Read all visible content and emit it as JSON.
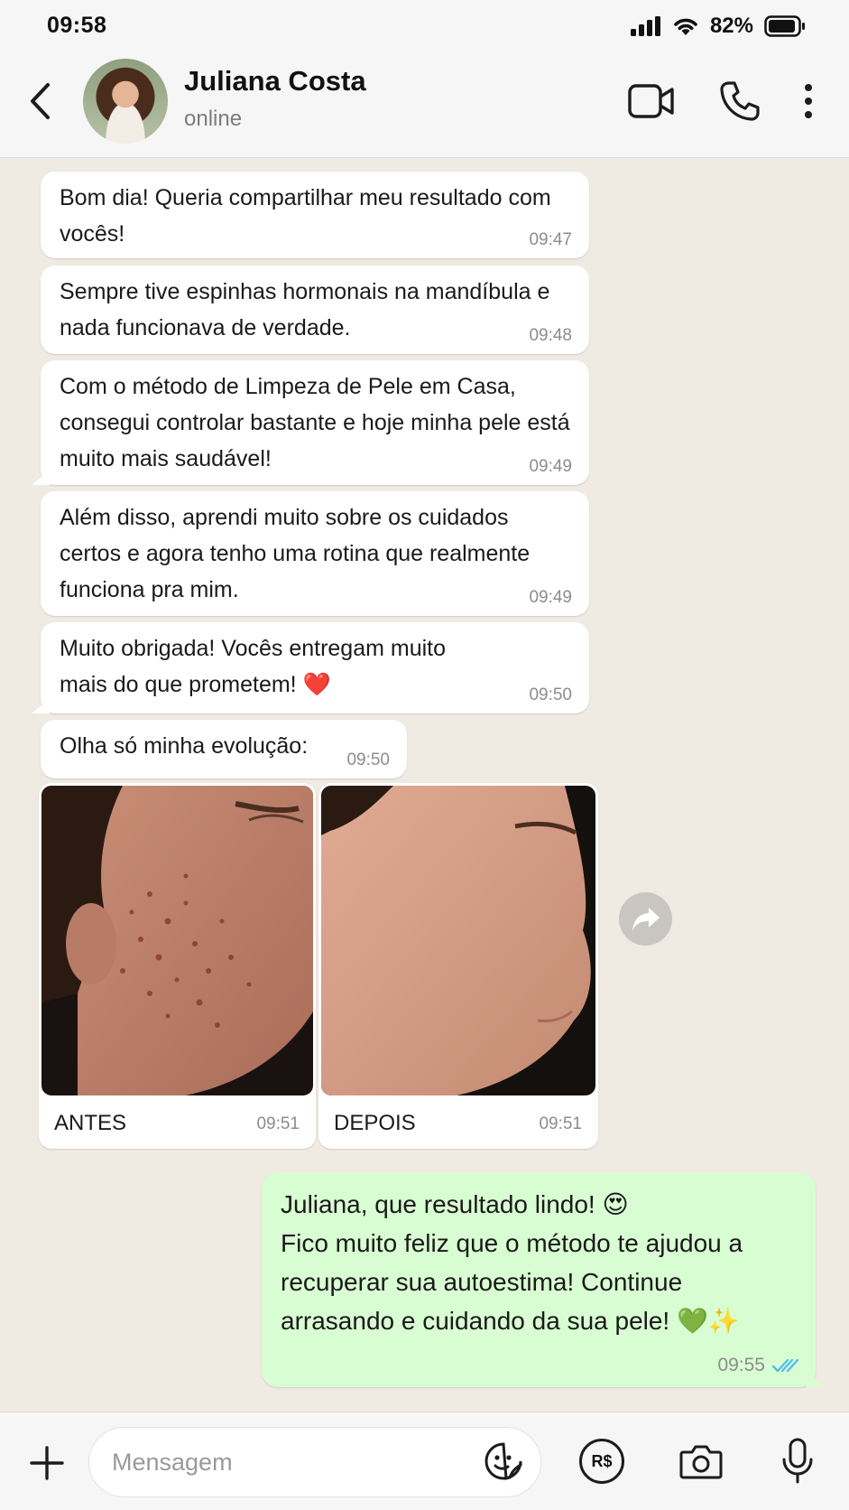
{
  "status_bar": {
    "time": "09:58",
    "battery": "82%"
  },
  "header": {
    "contact_name": "Juliana Costa",
    "contact_status": "online"
  },
  "messages": [
    {
      "text": "Bom dia! Queria compartilhar meu resultado com vocês!",
      "time": "09:47"
    },
    {
      "text": "Sempre tive espinhas hormonais na mandíbula e nada funcionava de verdade.",
      "time": "09:48"
    },
    {
      "text": "Com o método de Limpeza de Pele em Casa, consegui controlar bastante e hoje minha pele está muito mais saudável!",
      "time": "09:49"
    },
    {
      "text": "Além disso, aprendi muito sobre os cuidados certos e agora tenho uma rotina que realmente funciona pra mim.",
      "time": "09:49"
    },
    {
      "text": "Muito obrigada! Vocês entregam muito mais do que prometem! ❤️",
      "time": "09:50"
    },
    {
      "text": "Olha só minha evolução:",
      "time": "09:50"
    }
  ],
  "images": [
    {
      "caption": "ANTES",
      "time": "09:51"
    },
    {
      "caption": "DEPOIS",
      "time": "09:51"
    }
  ],
  "outgoing": {
    "text": "Juliana, que resultado lindo! 😍\nFico muito feliz que o método te ajudou a recuperar sua autoestima! Continue arrasando e cuidando da sua pele! 💚✨",
    "time": "09:55"
  },
  "composer": {
    "placeholder": "Mensagem",
    "pay_label": "R$"
  },
  "icons": [
    "back-arrow-icon",
    "video-call-icon",
    "phone-icon",
    "more-vert-icon",
    "forward-icon",
    "plus-icon",
    "sticker-icon",
    "camera-icon",
    "mic-icon",
    "double-check-icon"
  ],
  "colors": {
    "chat_bg": "#efeae2",
    "outgoing_bubble": "#d9fdd3",
    "read_tick": "#53bdeb"
  }
}
